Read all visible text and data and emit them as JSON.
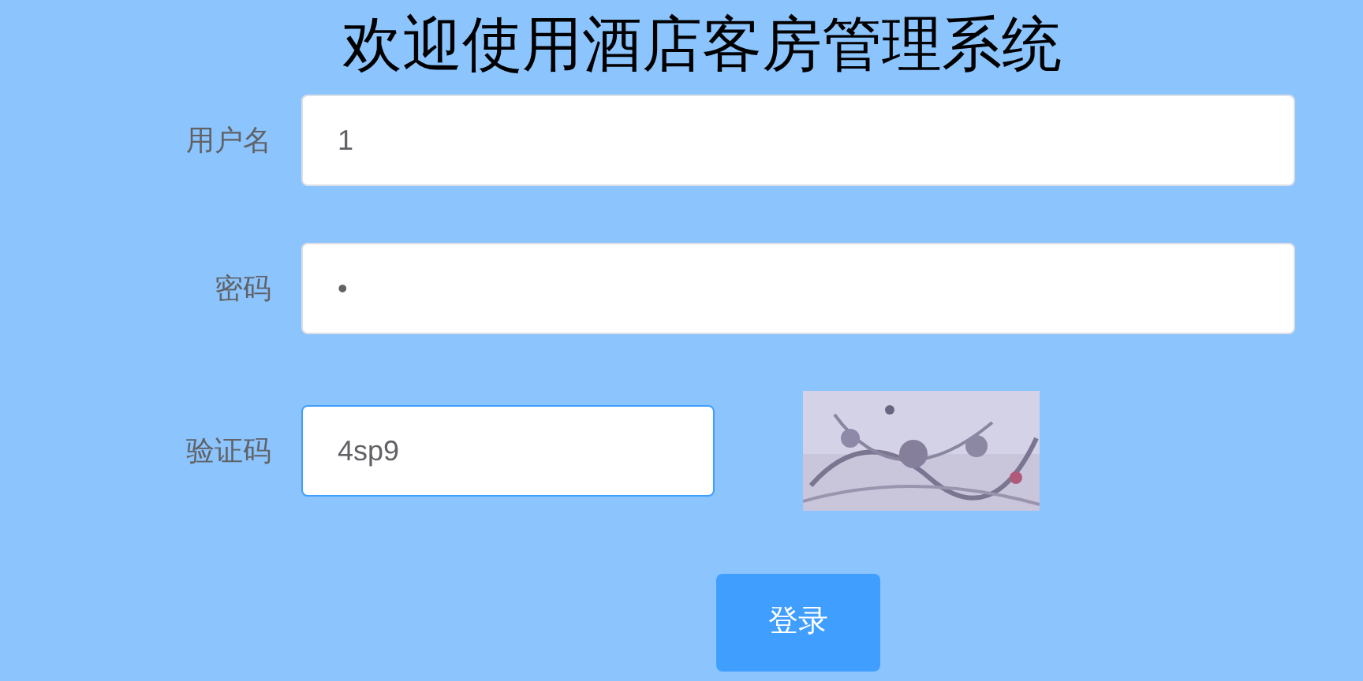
{
  "title": "欢迎使用酒店客房管理系统",
  "fields": [
    {
      "label": "用户名",
      "value": "1",
      "focused": false
    },
    {
      "label": "密码",
      "value": "•",
      "focused": false
    },
    {
      "label": "验证码",
      "value": "4sp9",
      "focused": true
    }
  ],
  "login_button": "登录"
}
